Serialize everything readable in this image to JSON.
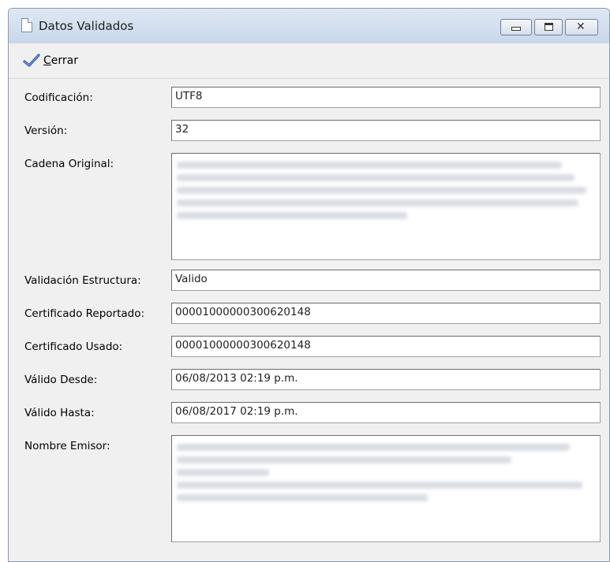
{
  "window": {
    "title": "Datos Validados"
  },
  "toolbar": {
    "close_prefix": "C",
    "close_rest": "errar"
  },
  "fields": [
    {
      "label": "Codificación:",
      "value": "UTF8"
    },
    {
      "label": "Versión:",
      "value": "32"
    },
    {
      "label": "Cadena Original:",
      "value": ""
    },
    {
      "label": "Validación Estructura:",
      "value": "Valido"
    },
    {
      "label": "Certificado Reportado:",
      "value": "00001000000300620148"
    },
    {
      "label": "Certificado Usado:",
      "value": "00001000000300620148"
    },
    {
      "label": "Válido Desde:",
      "value": "06/08/2013 02:19 p.m."
    },
    {
      "label": "Válido Hasta:",
      "value": "06/08/2017 02:19 p.m."
    },
    {
      "label": "Nombre Emisor:",
      "value": ""
    }
  ],
  "icons": {
    "window": "document-icon",
    "close_action": "checkmark-icon"
  },
  "colors": {
    "titlebar": "#c7d7ea",
    "window_bg": "#f0f0f0",
    "checkmark": "#2b4fb5"
  }
}
